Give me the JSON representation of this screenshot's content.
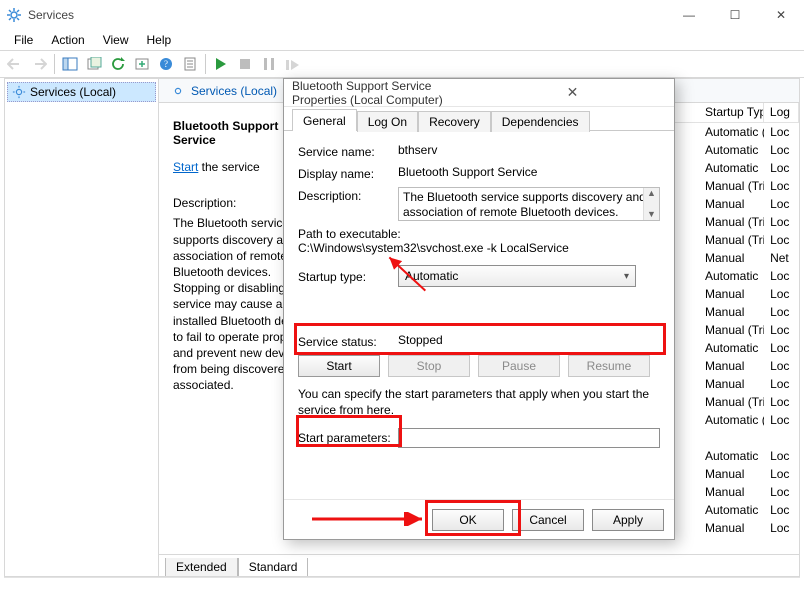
{
  "window": {
    "title": "Services",
    "sysbuttons": {
      "minimize": "—",
      "maximize": "☐",
      "close": "✕"
    }
  },
  "menubar": [
    "File",
    "Action",
    "View",
    "Help"
  ],
  "tree": {
    "root": "Services (Local)"
  },
  "right_header": "Services (Local)",
  "detail": {
    "selected_name": "Bluetooth Support Service",
    "action_link": "Start",
    "action_suffix": " the service",
    "desc_label": "Description:",
    "description": "The Bluetooth service supports discovery and association of remote Bluetooth devices.  Stopping or disabling this service may cause already installed Bluetooth devices to fail to operate properly and prevent new devices from being discovered or associated."
  },
  "list": {
    "headers": {
      "startup": "Startup Type",
      "logon": "Log"
    },
    "rows": [
      {
        "startup": "Automatic (D...",
        "log": "Loc"
      },
      {
        "startup": "Automatic",
        "log": "Loc"
      },
      {
        "startup": "Automatic",
        "log": "Loc"
      },
      {
        "startup": "Manual (Trig...",
        "log": "Loc"
      },
      {
        "startup": "Manual",
        "log": "Loc"
      },
      {
        "startup": "Manual (Trig...",
        "log": "Loc"
      },
      {
        "startup": "Manual (Trig...",
        "log": "Loc"
      },
      {
        "startup": "Manual",
        "log": "Net"
      },
      {
        "startup": "Automatic",
        "log": "Loc"
      },
      {
        "startup": "Manual",
        "log": "Loc"
      },
      {
        "startup": "Manual",
        "log": "Loc"
      },
      {
        "startup": "Manual (Trig...",
        "log": "Loc"
      },
      {
        "startup": "Automatic",
        "log": "Loc"
      },
      {
        "startup": "Manual",
        "log": "Loc"
      },
      {
        "startup": "Manual",
        "log": "Loc"
      },
      {
        "startup": "Manual (Trig...",
        "log": "Loc"
      },
      {
        "startup": "Automatic (D...",
        "log": "Loc"
      },
      {
        "startup": "",
        "log": ""
      },
      {
        "startup": "Automatic",
        "log": "Loc"
      },
      {
        "startup": "Manual",
        "log": "Loc"
      },
      {
        "startup": "Manual",
        "log": "Loc"
      },
      {
        "startup": "Automatic",
        "log": "Loc"
      },
      {
        "startup": "Manual",
        "log": "Loc"
      }
    ]
  },
  "tabs_bottom": {
    "extended": "Extended",
    "standard": "Standard"
  },
  "dialog": {
    "title": "Bluetooth Support Service Properties (Local Computer)",
    "tabs": [
      "General",
      "Log On",
      "Recovery",
      "Dependencies"
    ],
    "labels": {
      "service_name": "Service name:",
      "display_name": "Display name:",
      "description": "Description:",
      "path_label": "Path to executable:",
      "startup": "Startup type:",
      "status": "Service status:",
      "note": "You can specify the start parameters that apply when you start the service from here.",
      "params": "Start parameters:"
    },
    "values": {
      "service_name": "bthserv",
      "display_name": "Bluetooth Support Service",
      "description": "The Bluetooth service supports discovery and association of remote Bluetooth devices.  Stopping",
      "path": "C:\\Windows\\system32\\svchost.exe -k LocalService",
      "startup": "Automatic",
      "status": "Stopped",
      "params": ""
    },
    "buttons": {
      "start": "Start",
      "stop": "Stop",
      "pause": "Pause",
      "resume": "Resume",
      "ok": "OK",
      "cancel": "Cancel",
      "apply": "Apply"
    }
  }
}
